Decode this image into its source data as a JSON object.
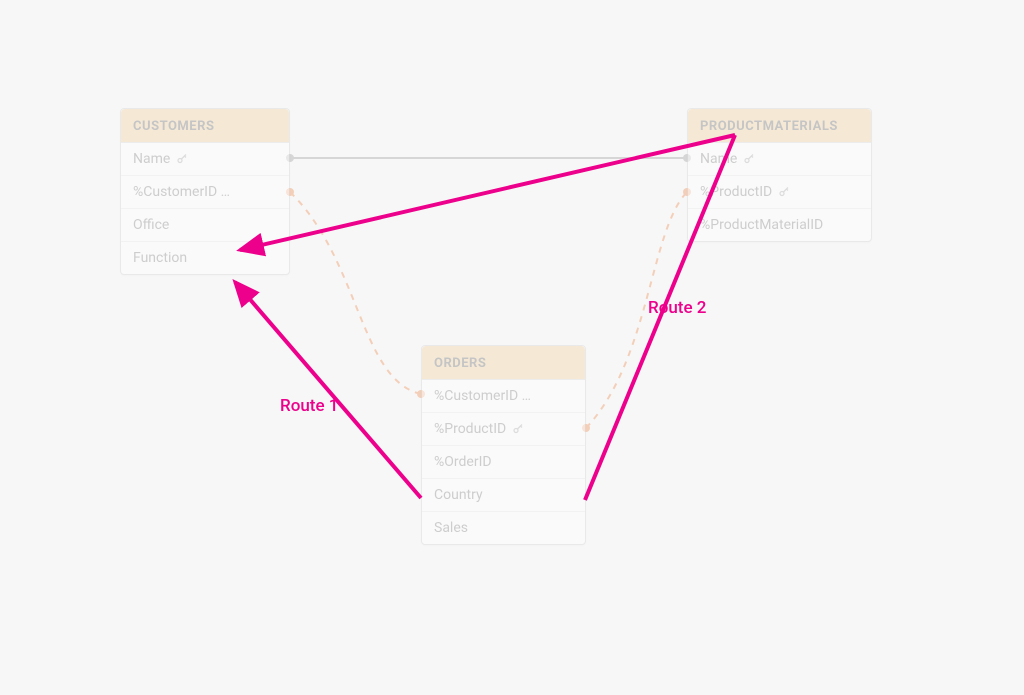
{
  "tables": {
    "customers": {
      "title": "CUSTOMERS",
      "fields": [
        {
          "label": "Name",
          "key": true
        },
        {
          "label": "%CustomerID …",
          "key": false
        },
        {
          "label": "Office",
          "key": false
        },
        {
          "label": "Function",
          "key": false
        }
      ]
    },
    "productmaterials": {
      "title": "PRODUCTMATERIALS",
      "fields": [
        {
          "label": "Name",
          "key": true
        },
        {
          "label": "%ProductID",
          "key": true
        },
        {
          "label": "%ProductMaterialID",
          "key": false
        }
      ]
    },
    "orders": {
      "title": "ORDERS",
      "fields": [
        {
          "label": "%CustomerID …",
          "key": false
        },
        {
          "label": "%ProductID",
          "key": true
        },
        {
          "label": "%OrderID",
          "key": false
        },
        {
          "label": "Country",
          "key": false
        },
        {
          "label": "Sales",
          "key": false
        }
      ]
    }
  },
  "routes": {
    "route1": "Route 1",
    "route2": "Route 2"
  },
  "colors": {
    "accent": "#ec008c",
    "tableHeader": "#f4d9b0",
    "connectorFaded": "#f0c9a8",
    "connectorSolid": "#d0d0d0"
  },
  "diagram_data": {
    "type": "er-diagram",
    "tables": [
      "CUSTOMERS",
      "PRODUCTMATERIALS",
      "ORDERS"
    ],
    "relationships": [
      {
        "from": "CUSTOMERS",
        "to": "PRODUCTMATERIALS",
        "style": "solid-faded"
      },
      {
        "from": "CUSTOMERS",
        "to": "ORDERS",
        "style": "dashed-faded"
      },
      {
        "from": "ORDERS",
        "to": "PRODUCTMATERIALS",
        "style": "dashed-faded"
      }
    ],
    "highlighted_routes": [
      {
        "name": "Route 1",
        "from": "ORDERS",
        "to": "CUSTOMERS",
        "direct": true
      },
      {
        "name": "Route 2",
        "from": "ORDERS",
        "via": "PRODUCTMATERIALS",
        "to": "CUSTOMERS"
      }
    ]
  }
}
